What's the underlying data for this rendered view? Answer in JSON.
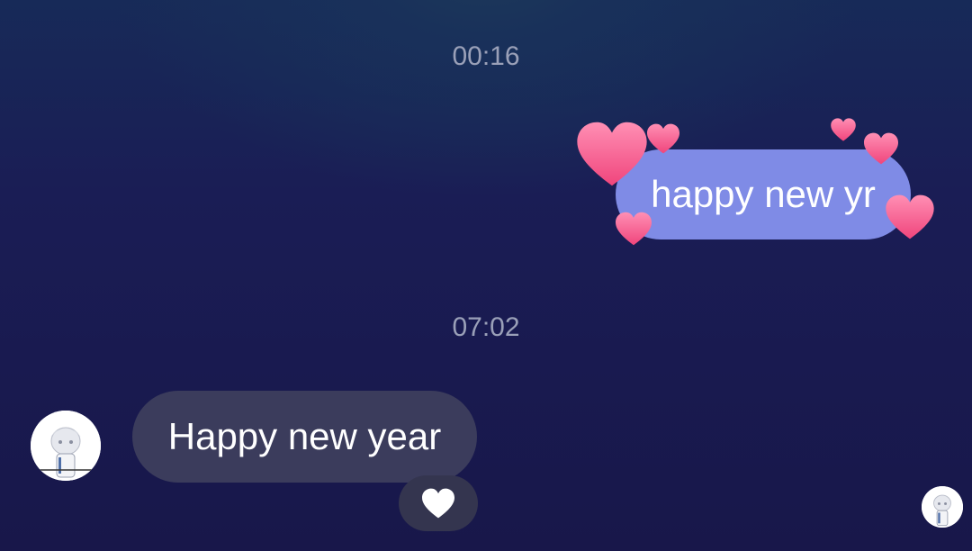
{
  "conversation": {
    "timestamps": [
      "00:16",
      "07:02"
    ],
    "messages": [
      {
        "direction": "outgoing",
        "text": "happy new yr",
        "effect": "hearts-effect"
      },
      {
        "direction": "incoming",
        "text": "Happy new year",
        "reaction": "white-heart-icon"
      }
    ]
  },
  "colors": {
    "background": "#1a1d55",
    "outgoing_bubble": "#7f8be6",
    "incoming_bubble": "#3b3c5c",
    "reaction_pill": "#34354f",
    "timestamp_text": "#9aa0b8",
    "heart_effect": "#ff5a8a"
  },
  "icons": [
    "pink-heart-icon",
    "white-heart-icon",
    "avatar"
  ]
}
